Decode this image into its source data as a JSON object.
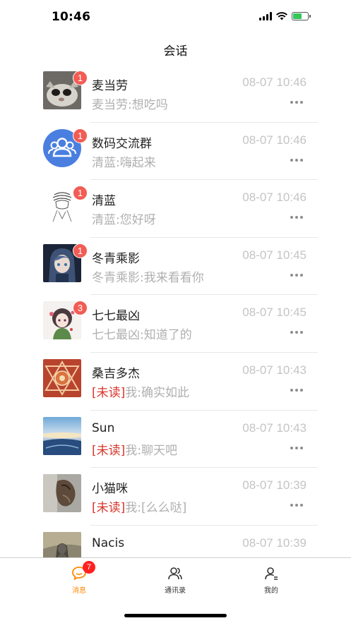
{
  "status": {
    "time": "10:46"
  },
  "nav": {
    "title": "会话"
  },
  "conversations": [
    {
      "name": "麦当劳",
      "time": "08-07 10:46",
      "badge": "1",
      "unread_tag": "",
      "preview": "麦当劳:想吃吗",
      "avatar": "cat-photo"
    },
    {
      "name": "数码交流群",
      "time": "08-07 10:46",
      "badge": "1",
      "unread_tag": "",
      "preview": "清蓝:嗨起来",
      "avatar": "group-icon"
    },
    {
      "name": "清蓝",
      "time": "08-07 10:46",
      "badge": "1",
      "unread_tag": "",
      "preview": "清蓝:您好呀",
      "avatar": "sketch-figure"
    },
    {
      "name": "冬青乘影",
      "time": "08-07 10:45",
      "badge": "1",
      "unread_tag": "",
      "preview": "冬青乘影:我来看看你",
      "avatar": "anime-girl"
    },
    {
      "name": "七七最凶",
      "time": "08-07 10:45",
      "badge": "3",
      "unread_tag": "",
      "preview": "七七最凶:知道了的",
      "avatar": "anime-chibi"
    },
    {
      "name": "桑吉多杰",
      "time": "08-07 10:43",
      "badge": "",
      "unread_tag": "[未读]",
      "preview": "我:确实如此",
      "avatar": "mandala"
    },
    {
      "name": "Sun",
      "time": "08-07 10:43",
      "badge": "",
      "unread_tag": "[未读]",
      "preview": "我:聊天吧",
      "avatar": "landscape"
    },
    {
      "name": "小猫咪",
      "time": "08-07 10:39",
      "badge": "",
      "unread_tag": "[未读]",
      "preview": "我:[么么哒]",
      "avatar": "cat-photo-2"
    },
    {
      "name": "Nacis",
      "time": "08-07 10:39",
      "badge": "",
      "unread_tag": "",
      "preview": "",
      "avatar": "ink-figure"
    }
  ],
  "tabbar": {
    "messages": {
      "label": "消息",
      "badge": "7"
    },
    "contacts": {
      "label": "通讯录"
    },
    "me": {
      "label": "我的"
    }
  },
  "colors": {
    "accent": "#ff8a00",
    "badge": "#f25c54",
    "unread": "#d9352b",
    "group_avatar": "#4a7fe0"
  }
}
